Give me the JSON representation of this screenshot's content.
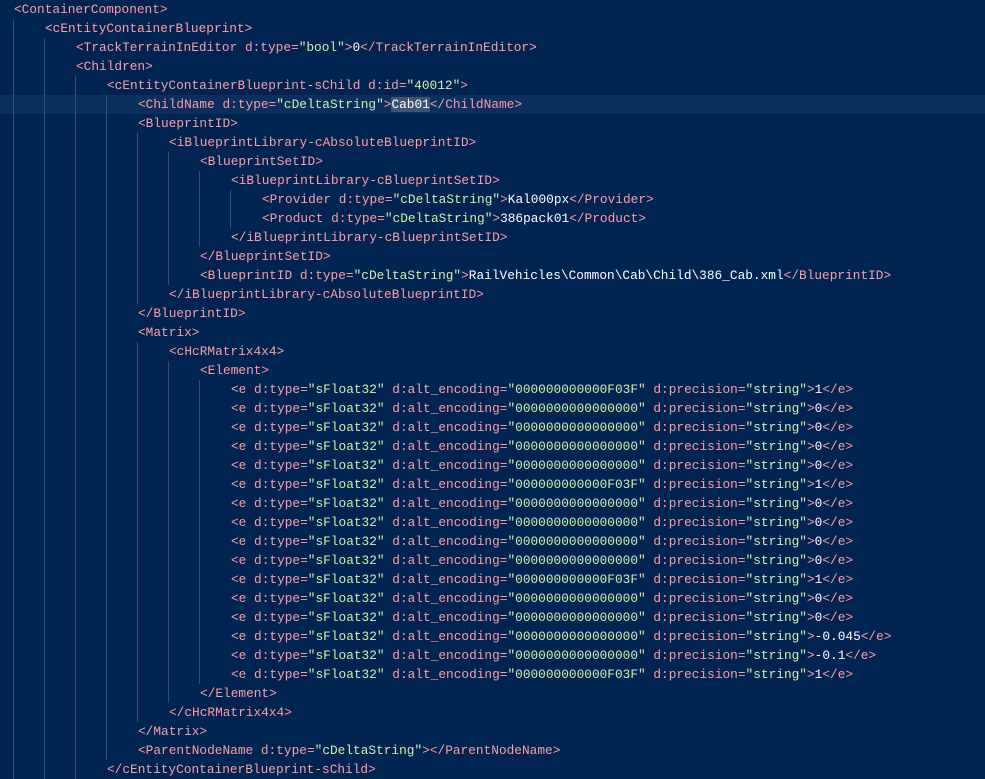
{
  "colors": {
    "background": "#002451",
    "tag": "#ff9da4",
    "string": "#d1f1a9",
    "text": "#ffffff"
  },
  "lines": [
    {
      "indent": 0,
      "segs": [
        [
          "p",
          "<ContainerComponent>"
        ]
      ]
    },
    {
      "indent": 1,
      "segs": [
        [
          "p",
          "<cEntityContainerBlueprint>"
        ]
      ]
    },
    {
      "indent": 2,
      "segs": [
        [
          "p",
          "<TrackTerrainInEditor d:type="
        ],
        [
          "s",
          "\"bool\""
        ],
        [
          "p",
          ">"
        ],
        [
          "t",
          "0"
        ],
        [
          "p",
          "</TrackTerrainInEditor>"
        ]
      ]
    },
    {
      "indent": 2,
      "segs": [
        [
          "p",
          "<Children>"
        ]
      ]
    },
    {
      "indent": 3,
      "segs": [
        [
          "p",
          "<cEntityContainerBlueprint-sChild d:id="
        ],
        [
          "s",
          "\"40012\""
        ],
        [
          "p",
          ">"
        ]
      ]
    },
    {
      "indent": 4,
      "current": true,
      "segs": [
        [
          "p",
          "<ChildName d:type="
        ],
        [
          "s",
          "\"cDeltaString\""
        ],
        [
          "p",
          ">"
        ],
        [
          "t",
          "Cab01",
          true
        ],
        [
          "p",
          "</ChildName>"
        ]
      ]
    },
    {
      "indent": 4,
      "segs": [
        [
          "p",
          "<BlueprintID>"
        ]
      ]
    },
    {
      "indent": 5,
      "segs": [
        [
          "p",
          "<iBlueprintLibrary-cAbsoluteBlueprintID>"
        ]
      ]
    },
    {
      "indent": 6,
      "segs": [
        [
          "p",
          "<BlueprintSetID>"
        ]
      ]
    },
    {
      "indent": 7,
      "segs": [
        [
          "p",
          "<iBlueprintLibrary-cBlueprintSetID>"
        ]
      ]
    },
    {
      "indent": 8,
      "segs": [
        [
          "p",
          "<Provider d:type="
        ],
        [
          "s",
          "\"cDeltaString\""
        ],
        [
          "p",
          ">"
        ],
        [
          "t",
          "Kal000px"
        ],
        [
          "p",
          "</Provider>"
        ]
      ]
    },
    {
      "indent": 8,
      "segs": [
        [
          "p",
          "<Product d:type="
        ],
        [
          "s",
          "\"cDeltaString\""
        ],
        [
          "p",
          ">"
        ],
        [
          "t",
          "386pack01"
        ],
        [
          "p",
          "</Product>"
        ]
      ]
    },
    {
      "indent": 7,
      "segs": [
        [
          "p",
          "</iBlueprintLibrary-cBlueprintSetID>"
        ]
      ]
    },
    {
      "indent": 6,
      "segs": [
        [
          "p",
          "</BlueprintSetID>"
        ]
      ]
    },
    {
      "indent": 6,
      "segs": [
        [
          "p",
          "<BlueprintID d:type="
        ],
        [
          "s",
          "\"cDeltaString\""
        ],
        [
          "p",
          ">"
        ],
        [
          "t",
          "RailVehicles\\Common\\Cab\\Child\\386_Cab.xml"
        ],
        [
          "p",
          "</BlueprintID>"
        ]
      ]
    },
    {
      "indent": 5,
      "segs": [
        [
          "p",
          "</iBlueprintLibrary-cAbsoluteBlueprintID>"
        ]
      ]
    },
    {
      "indent": 4,
      "segs": [
        [
          "p",
          "</BlueprintID>"
        ]
      ]
    },
    {
      "indent": 4,
      "segs": [
        [
          "p",
          "<Matrix>"
        ]
      ]
    },
    {
      "indent": 5,
      "segs": [
        [
          "p",
          "<cHcRMatrix4x4>"
        ]
      ]
    },
    {
      "indent": 6,
      "segs": [
        [
          "p",
          "<Element>"
        ]
      ]
    },
    {
      "indent": 7,
      "segs": [
        [
          "p",
          "<e d:type="
        ],
        [
          "s",
          "\"sFloat32\""
        ],
        [
          "p",
          " d:alt_encoding="
        ],
        [
          "s",
          "\"000000000000F03F\""
        ],
        [
          "p",
          " d:precision="
        ],
        [
          "s",
          "\"string\""
        ],
        [
          "p",
          ">"
        ],
        [
          "t",
          "1"
        ],
        [
          "p",
          "</e>"
        ]
      ]
    },
    {
      "indent": 7,
      "segs": [
        [
          "p",
          "<e d:type="
        ],
        [
          "s",
          "\"sFloat32\""
        ],
        [
          "p",
          " d:alt_encoding="
        ],
        [
          "s",
          "\"0000000000000000\""
        ],
        [
          "p",
          " d:precision="
        ],
        [
          "s",
          "\"string\""
        ],
        [
          "p",
          ">"
        ],
        [
          "t",
          "0"
        ],
        [
          "p",
          "</e>"
        ]
      ]
    },
    {
      "indent": 7,
      "segs": [
        [
          "p",
          "<e d:type="
        ],
        [
          "s",
          "\"sFloat32\""
        ],
        [
          "p",
          " d:alt_encoding="
        ],
        [
          "s",
          "\"0000000000000000\""
        ],
        [
          "p",
          " d:precision="
        ],
        [
          "s",
          "\"string\""
        ],
        [
          "p",
          ">"
        ],
        [
          "t",
          "0"
        ],
        [
          "p",
          "</e>"
        ]
      ]
    },
    {
      "indent": 7,
      "segs": [
        [
          "p",
          "<e d:type="
        ],
        [
          "s",
          "\"sFloat32\""
        ],
        [
          "p",
          " d:alt_encoding="
        ],
        [
          "s",
          "\"0000000000000000\""
        ],
        [
          "p",
          " d:precision="
        ],
        [
          "s",
          "\"string\""
        ],
        [
          "p",
          ">"
        ],
        [
          "t",
          "0"
        ],
        [
          "p",
          "</e>"
        ]
      ]
    },
    {
      "indent": 7,
      "segs": [
        [
          "p",
          "<e d:type="
        ],
        [
          "s",
          "\"sFloat32\""
        ],
        [
          "p",
          " d:alt_encoding="
        ],
        [
          "s",
          "\"0000000000000000\""
        ],
        [
          "p",
          " d:precision="
        ],
        [
          "s",
          "\"string\""
        ],
        [
          "p",
          ">"
        ],
        [
          "t",
          "0"
        ],
        [
          "p",
          "</e>"
        ]
      ]
    },
    {
      "indent": 7,
      "segs": [
        [
          "p",
          "<e d:type="
        ],
        [
          "s",
          "\"sFloat32\""
        ],
        [
          "p",
          " d:alt_encoding="
        ],
        [
          "s",
          "\"000000000000F03F\""
        ],
        [
          "p",
          " d:precision="
        ],
        [
          "s",
          "\"string\""
        ],
        [
          "p",
          ">"
        ],
        [
          "t",
          "1"
        ],
        [
          "p",
          "</e>"
        ]
      ]
    },
    {
      "indent": 7,
      "segs": [
        [
          "p",
          "<e d:type="
        ],
        [
          "s",
          "\"sFloat32\""
        ],
        [
          "p",
          " d:alt_encoding="
        ],
        [
          "s",
          "\"0000000000000000\""
        ],
        [
          "p",
          " d:precision="
        ],
        [
          "s",
          "\"string\""
        ],
        [
          "p",
          ">"
        ],
        [
          "t",
          "0"
        ],
        [
          "p",
          "</e>"
        ]
      ]
    },
    {
      "indent": 7,
      "segs": [
        [
          "p",
          "<e d:type="
        ],
        [
          "s",
          "\"sFloat32\""
        ],
        [
          "p",
          " d:alt_encoding="
        ],
        [
          "s",
          "\"0000000000000000\""
        ],
        [
          "p",
          " d:precision="
        ],
        [
          "s",
          "\"string\""
        ],
        [
          "p",
          ">"
        ],
        [
          "t",
          "0"
        ],
        [
          "p",
          "</e>"
        ]
      ]
    },
    {
      "indent": 7,
      "segs": [
        [
          "p",
          "<e d:type="
        ],
        [
          "s",
          "\"sFloat32\""
        ],
        [
          "p",
          " d:alt_encoding="
        ],
        [
          "s",
          "\"0000000000000000\""
        ],
        [
          "p",
          " d:precision="
        ],
        [
          "s",
          "\"string\""
        ],
        [
          "p",
          ">"
        ],
        [
          "t",
          "0"
        ],
        [
          "p",
          "</e>"
        ]
      ]
    },
    {
      "indent": 7,
      "segs": [
        [
          "p",
          "<e d:type="
        ],
        [
          "s",
          "\"sFloat32\""
        ],
        [
          "p",
          " d:alt_encoding="
        ],
        [
          "s",
          "\"0000000000000000\""
        ],
        [
          "p",
          " d:precision="
        ],
        [
          "s",
          "\"string\""
        ],
        [
          "p",
          ">"
        ],
        [
          "t",
          "0"
        ],
        [
          "p",
          "</e>"
        ]
      ]
    },
    {
      "indent": 7,
      "segs": [
        [
          "p",
          "<e d:type="
        ],
        [
          "s",
          "\"sFloat32\""
        ],
        [
          "p",
          " d:alt_encoding="
        ],
        [
          "s",
          "\"000000000000F03F\""
        ],
        [
          "p",
          " d:precision="
        ],
        [
          "s",
          "\"string\""
        ],
        [
          "p",
          ">"
        ],
        [
          "t",
          "1"
        ],
        [
          "p",
          "</e>"
        ]
      ]
    },
    {
      "indent": 7,
      "segs": [
        [
          "p",
          "<e d:type="
        ],
        [
          "s",
          "\"sFloat32\""
        ],
        [
          "p",
          " d:alt_encoding="
        ],
        [
          "s",
          "\"0000000000000000\""
        ],
        [
          "p",
          " d:precision="
        ],
        [
          "s",
          "\"string\""
        ],
        [
          "p",
          ">"
        ],
        [
          "t",
          "0"
        ],
        [
          "p",
          "</e>"
        ]
      ]
    },
    {
      "indent": 7,
      "segs": [
        [
          "p",
          "<e d:type="
        ],
        [
          "s",
          "\"sFloat32\""
        ],
        [
          "p",
          " d:alt_encoding="
        ],
        [
          "s",
          "\"0000000000000000\""
        ],
        [
          "p",
          " d:precision="
        ],
        [
          "s",
          "\"string\""
        ],
        [
          "p",
          ">"
        ],
        [
          "t",
          "0"
        ],
        [
          "p",
          "</e>"
        ]
      ]
    },
    {
      "indent": 7,
      "segs": [
        [
          "p",
          "<e d:type="
        ],
        [
          "s",
          "\"sFloat32\""
        ],
        [
          "p",
          " d:alt_encoding="
        ],
        [
          "s",
          "\"0000000000000000\""
        ],
        [
          "p",
          " d:precision="
        ],
        [
          "s",
          "\"string\""
        ],
        [
          "p",
          ">"
        ],
        [
          "t",
          "-0.045"
        ],
        [
          "p",
          "</e>"
        ]
      ]
    },
    {
      "indent": 7,
      "segs": [
        [
          "p",
          "<e d:type="
        ],
        [
          "s",
          "\"sFloat32\""
        ],
        [
          "p",
          " d:alt_encoding="
        ],
        [
          "s",
          "\"0000000000000000\""
        ],
        [
          "p",
          " d:precision="
        ],
        [
          "s",
          "\"string\""
        ],
        [
          "p",
          ">"
        ],
        [
          "t",
          "-0.1"
        ],
        [
          "p",
          "</e>"
        ]
      ]
    },
    {
      "indent": 7,
      "segs": [
        [
          "p",
          "<e d:type="
        ],
        [
          "s",
          "\"sFloat32\""
        ],
        [
          "p",
          " d:alt_encoding="
        ],
        [
          "s",
          "\"000000000000F03F\""
        ],
        [
          "p",
          " d:precision="
        ],
        [
          "s",
          "\"string\""
        ],
        [
          "p",
          ">"
        ],
        [
          "t",
          "1"
        ],
        [
          "p",
          "</e>"
        ]
      ]
    },
    {
      "indent": 6,
      "segs": [
        [
          "p",
          "</Element>"
        ]
      ]
    },
    {
      "indent": 5,
      "segs": [
        [
          "p",
          "</cHcRMatrix4x4>"
        ]
      ]
    },
    {
      "indent": 4,
      "segs": [
        [
          "p",
          "</Matrix>"
        ]
      ]
    },
    {
      "indent": 4,
      "segs": [
        [
          "p",
          "<ParentNodeName d:type="
        ],
        [
          "s",
          "\"cDeltaString\""
        ],
        [
          "p",
          "></ParentNodeName>"
        ]
      ]
    },
    {
      "indent": 3,
      "segs": [
        [
          "p",
          "</cEntityContainerBlueprint-sChild>"
        ]
      ]
    }
  ]
}
